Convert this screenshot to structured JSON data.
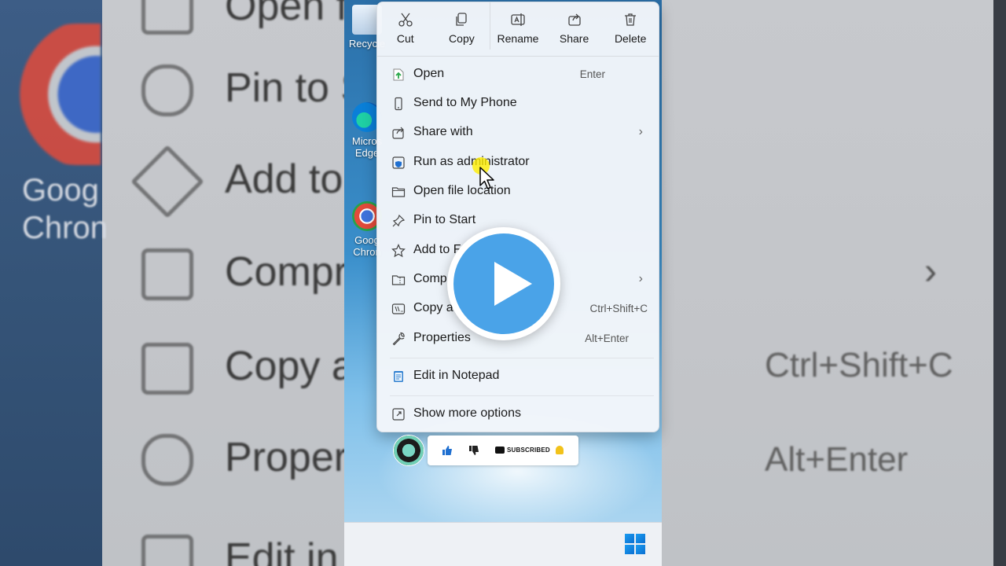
{
  "background": {
    "rows": [
      {
        "text": "Open fi"
      },
      {
        "text": "Pin to S"
      },
      {
        "text": "Add to"
      },
      {
        "text": "Compre"
      },
      {
        "text": "Copy as"
      },
      {
        "text": "Propert"
      },
      {
        "text": "Edit in"
      }
    ],
    "shortcuts": {
      "copy_as_path": "Ctrl+Shift+C",
      "properties": "Alt+Enter"
    },
    "chrome_label": "Goog\nChron"
  },
  "desktop": {
    "icons": [
      {
        "label": "Recycle",
        "icon": "recycle-bin-icon"
      },
      {
        "label": "Micros\nEdge",
        "icon": "edge-icon"
      },
      {
        "label": "Goog\nChron",
        "icon": "chrome-icon"
      }
    ]
  },
  "menu": {
    "toolbar": [
      {
        "label": "Cut",
        "icon": "scissors-icon"
      },
      {
        "label": "Copy",
        "icon": "copy-icon"
      },
      {
        "label": "Rename",
        "icon": "rename-icon"
      },
      {
        "label": "Share",
        "icon": "share-icon"
      },
      {
        "label": "Delete",
        "icon": "trash-icon"
      }
    ],
    "items": [
      {
        "label": "Open",
        "shortcut": "Enter",
        "icon": "open-icon"
      },
      {
        "label": "Send to My Phone",
        "shortcut": "",
        "icon": "phone-icon"
      },
      {
        "label": "Share with",
        "shortcut": "",
        "icon": "share-with-icon",
        "submenu": true
      },
      {
        "label": "Run as administrator",
        "shortcut": "",
        "icon": "shield-icon"
      },
      {
        "label": "Open file location",
        "shortcut": "",
        "icon": "folder-icon"
      },
      {
        "label": "Pin to Start",
        "shortcut": "",
        "icon": "pin-icon"
      },
      {
        "label": "Add to F",
        "shortcut": "",
        "icon": "star-icon"
      },
      {
        "label": "Comp",
        "shortcut": "",
        "icon": "zip-folder-icon",
        "submenu": true
      },
      {
        "label": "Copy as",
        "shortcut": "Ctrl+Shift+C",
        "icon": "copy-path-icon"
      },
      {
        "label": "Properties",
        "shortcut": "Alt+Enter",
        "icon": "wrench-icon"
      },
      {
        "label": "Edit in Notepad",
        "shortcut": "",
        "icon": "notepad-icon"
      },
      {
        "label": "Show more options",
        "shortcut": "",
        "icon": "more-options-icon"
      }
    ],
    "chevron": "›"
  },
  "subscribe": {
    "label": "SUBSCRIBED"
  },
  "colors": {
    "accent": "#4aa3e8",
    "menu_bg": "#f3f6fa",
    "wallpaper": "#3a8fcb"
  }
}
